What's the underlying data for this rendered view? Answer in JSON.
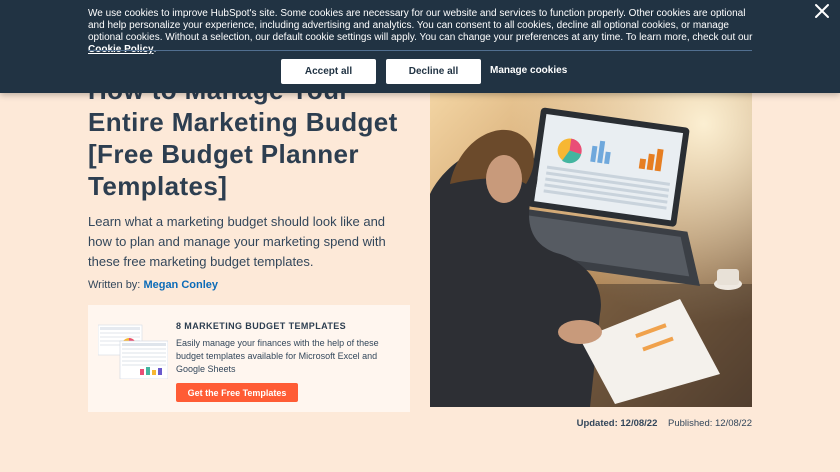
{
  "cookie_banner": {
    "text": "We use cookies to improve HubSpot's site. Some cookies are necessary for our website and services to function properly. Other cookies are optional and help personalize your experience, including advertising and analytics. You can consent to all cookies, decline all optional cookies, or manage optional cookies. Without a selection, our default cookie settings will apply. You can change your preferences at any time. To learn more, check out our",
    "policy_link": "Cookie Policy",
    "accept_label": "Accept all",
    "decline_label": "Decline all",
    "manage_label": "Manage cookies",
    "close_icon": "close-icon"
  },
  "article": {
    "title": "How to Manage Your Entire Marketing Budget [Free Budget Planner Templates]",
    "intro": "Learn what a marketing budget should look like and how to plan and manage your marketing spend with these free marketing budget templates.",
    "written_by_label": "Written by:",
    "author": "Megan Conley",
    "updated": "Updated: 12/08/22",
    "published": "Published: 12/08/22"
  },
  "promo": {
    "heading": "8 MARKETING BUDGET TEMPLATES",
    "text": "Easily manage your finances with the help of these budget templates available for Microsoft Excel and Google Sheets",
    "button_label": "Get the Free Templates"
  },
  "colors": {
    "page_bg": "#fde9d8",
    "banner_bg": "#213343",
    "accent": "#ff5c35",
    "link": "#0b6bb8"
  }
}
